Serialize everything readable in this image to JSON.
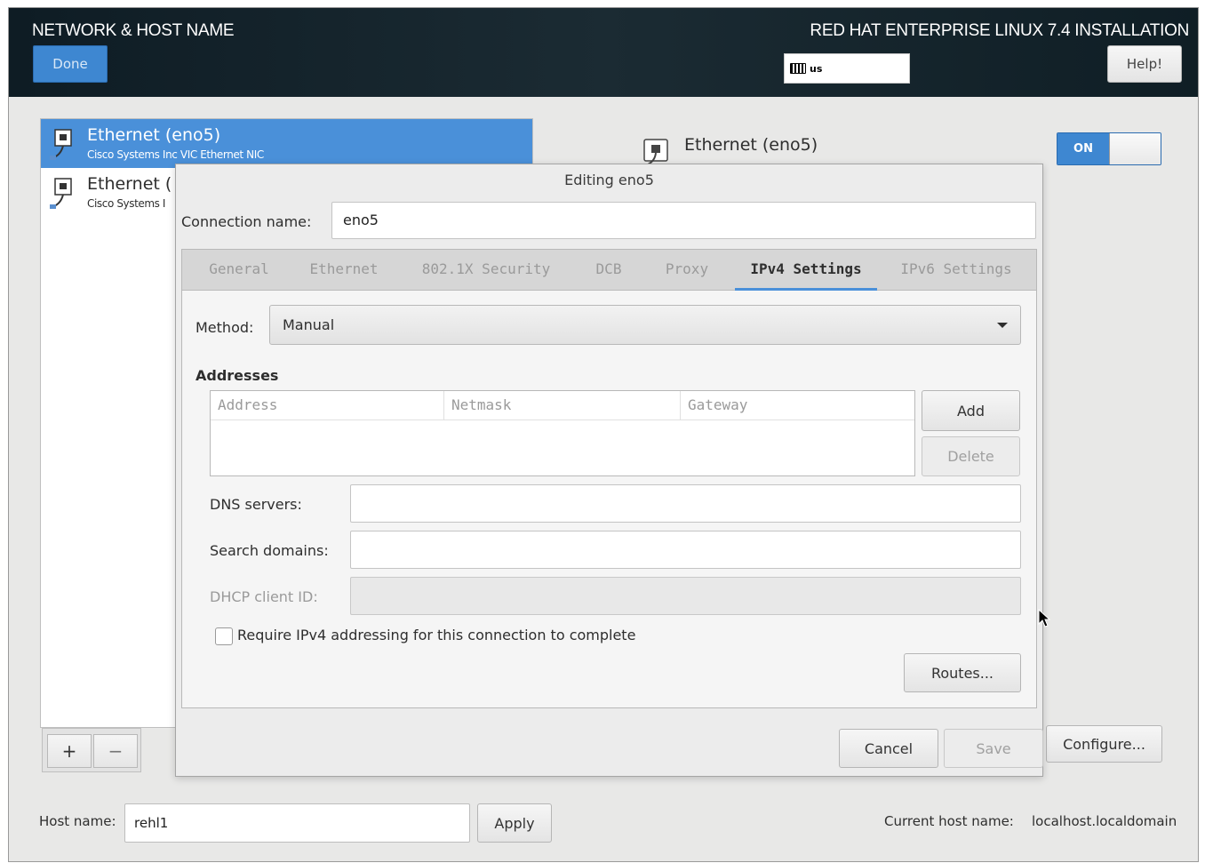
{
  "header": {
    "title": "NETWORK & HOST NAME",
    "done_label": "Done",
    "product": "RED HAT ENTERPRISE LINUX 7.4 INSTALLATION",
    "keyboard_layout": "us",
    "help_label": "Help!"
  },
  "devices": [
    {
      "name": "Ethernet (eno5)",
      "description": "Cisco Systems Inc VIC Ethernet NIC",
      "selected": true
    },
    {
      "name": "Ethernet (",
      "description": "Cisco Systems I",
      "selected": false
    }
  ],
  "list_controls": {
    "add_label": "+",
    "remove_label": "−"
  },
  "detail": {
    "device_name": "Ethernet (eno5)",
    "toggle_label": "ON",
    "configure_label": "Configure..."
  },
  "dialog": {
    "title": "Editing eno5",
    "connection_name_label": "Connection name:",
    "connection_name_value": "eno5",
    "tabs": [
      {
        "label": "General",
        "active": false
      },
      {
        "label": "Ethernet",
        "active": false
      },
      {
        "label": "802.1X Security",
        "active": false
      },
      {
        "label": "DCB",
        "active": false
      },
      {
        "label": "Proxy",
        "active": false
      },
      {
        "label": "IPv4 Settings",
        "active": true
      },
      {
        "label": "IPv6 Settings",
        "active": false
      }
    ],
    "method_label": "Method:",
    "method_value": "Manual",
    "addresses_heading": "Addresses",
    "address_columns": [
      "Address",
      "Netmask",
      "Gateway"
    ],
    "add_label": "Add",
    "delete_label": "Delete",
    "dns_label": "DNS servers:",
    "search_label": "Search domains:",
    "dhcp_label": "DHCP client ID:",
    "require_label": "Require IPv4 addressing for this connection to complete",
    "require_checked": false,
    "routes_label": "Routes...",
    "cancel_label": "Cancel",
    "save_label": "Save"
  },
  "hostbar": {
    "host_label": "Host name:",
    "host_value": "rehl1",
    "apply_label": "Apply",
    "current_label": "Current host name:",
    "current_value": "localhost.localdomain"
  },
  "colors": {
    "accent": "#4a90d9",
    "header_bg": "#14232b",
    "window_bg": "#e8e8e7"
  }
}
